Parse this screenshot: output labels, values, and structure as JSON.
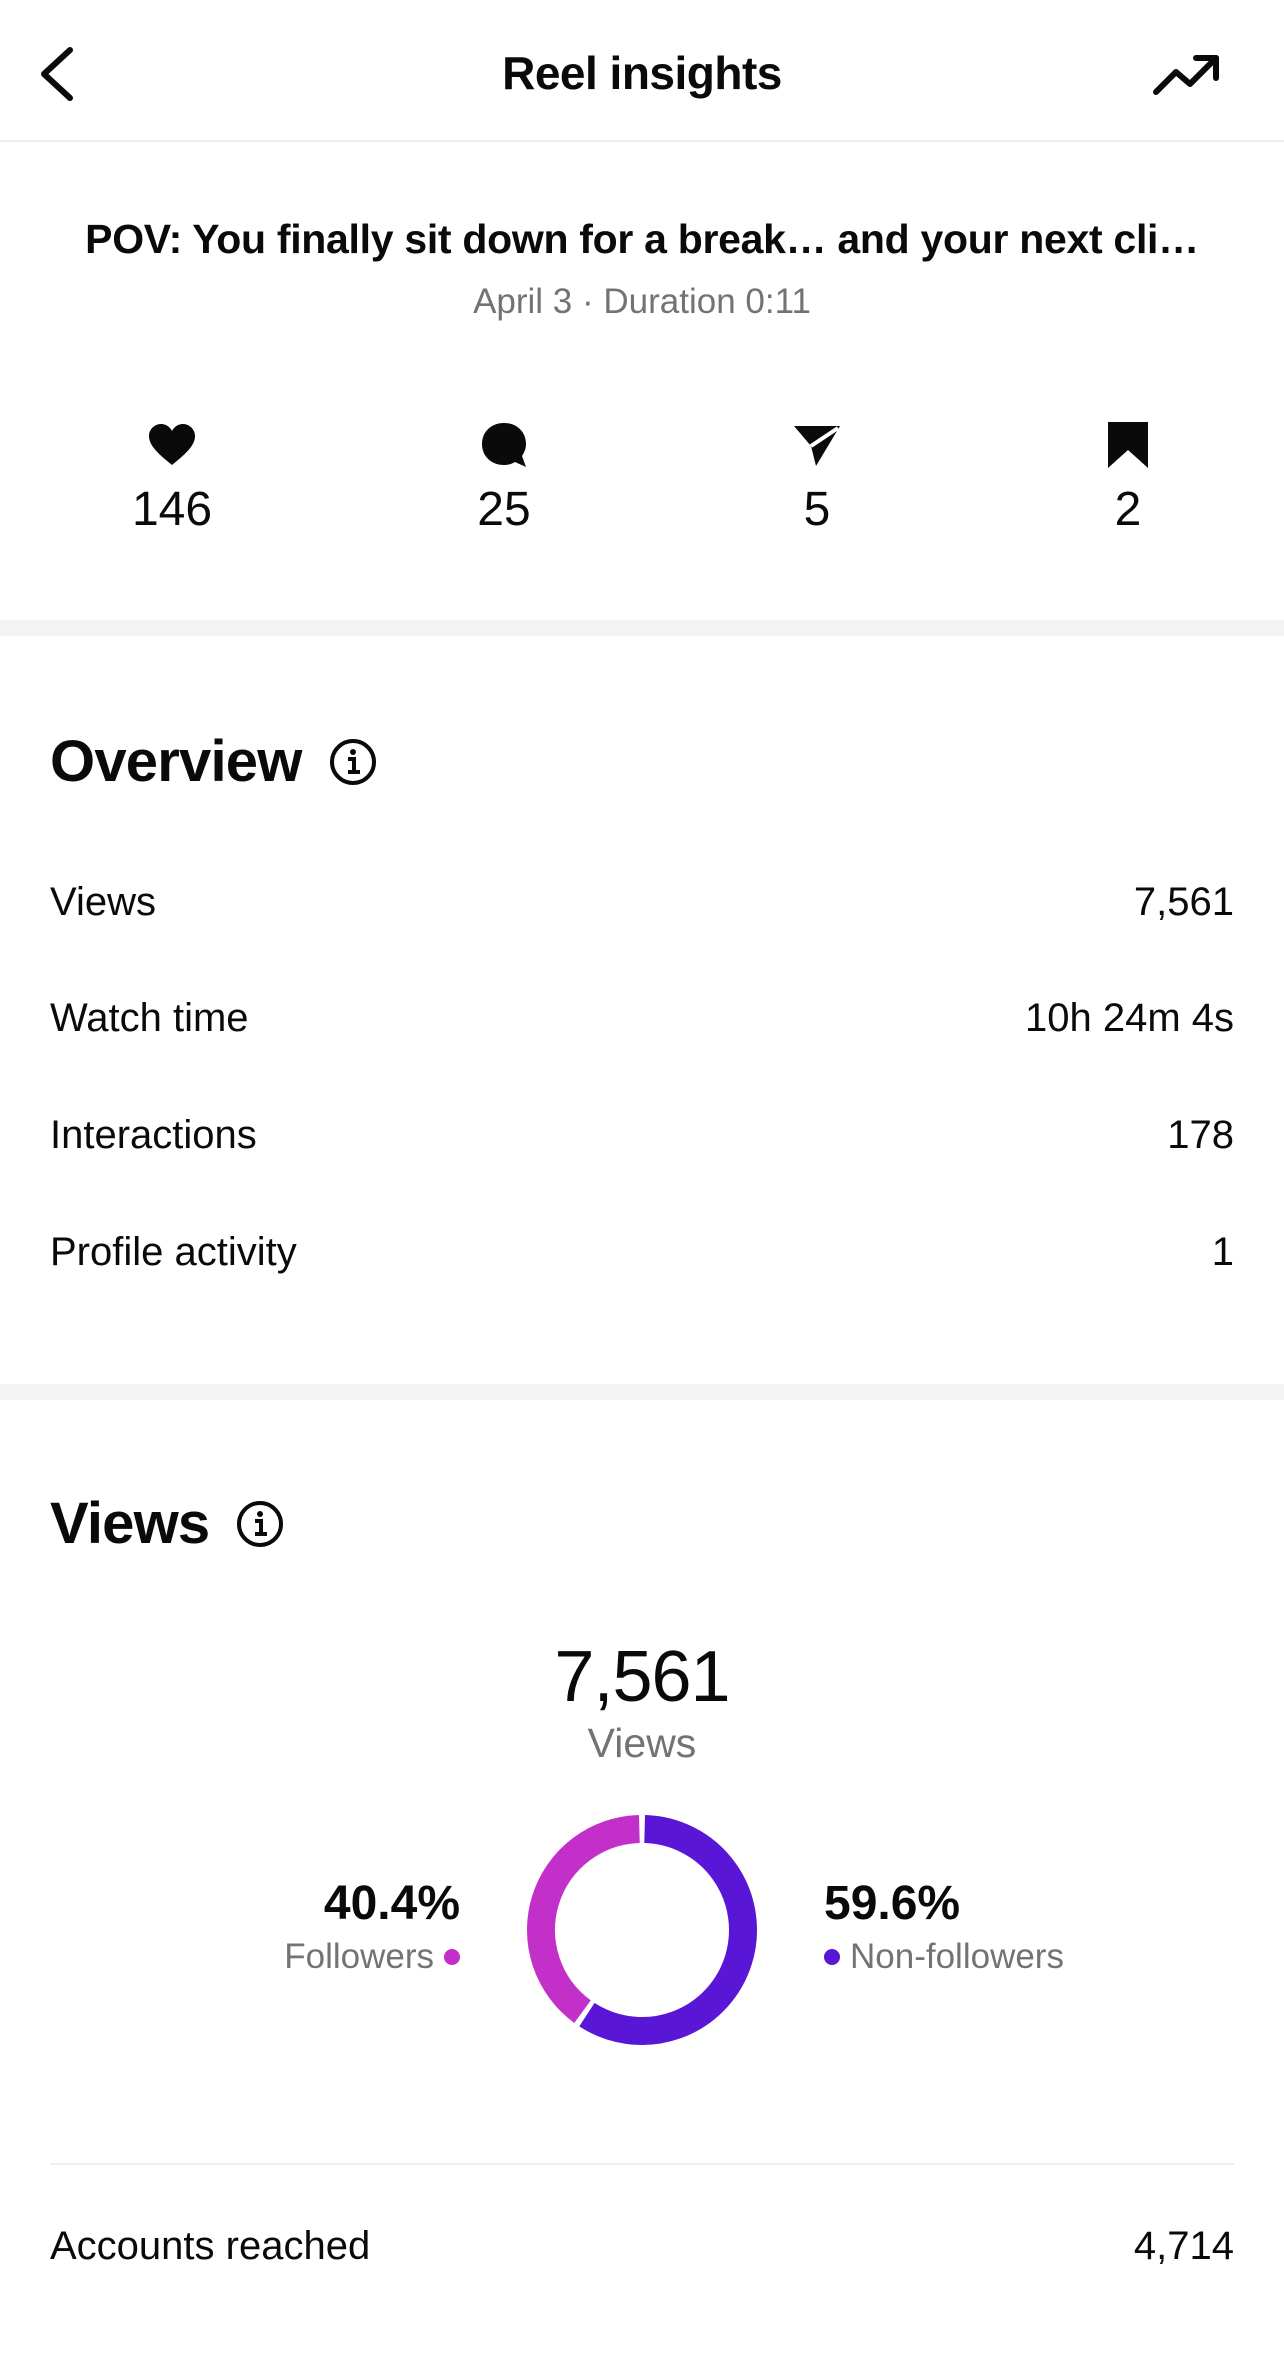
{
  "header": {
    "title": "Reel insights",
    "back_icon": "chevron-left-icon",
    "trend_icon": "trending-up-icon"
  },
  "reel": {
    "caption": "POV: You finally sit down for a break… and your next cli…",
    "meta": "April 3 · Duration 0:11"
  },
  "engagement": {
    "likes": "146",
    "comments": "25",
    "shares": "5",
    "saves": "2"
  },
  "overview": {
    "title": "Overview",
    "rows": [
      {
        "label": "Views",
        "value": "7,561"
      },
      {
        "label": "Watch time",
        "value": "10h 24m 4s"
      },
      {
        "label": "Interactions",
        "value": "178"
      },
      {
        "label": "Profile activity",
        "value": "1"
      }
    ]
  },
  "views": {
    "title": "Views",
    "total": "7,561",
    "total_label": "Views",
    "followers_pct": "40.4%",
    "followers_label": "Followers",
    "nonfollowers_pct": "59.6%",
    "nonfollowers_label": "Non-followers",
    "followers_fraction": 0.404,
    "accounts_reached_label": "Accounts reached",
    "accounts_reached_value": "4,714"
  },
  "colors": {
    "followers": "#c330c9",
    "nonfollowers": "#5a16d6",
    "muted_text": "#737373"
  }
}
